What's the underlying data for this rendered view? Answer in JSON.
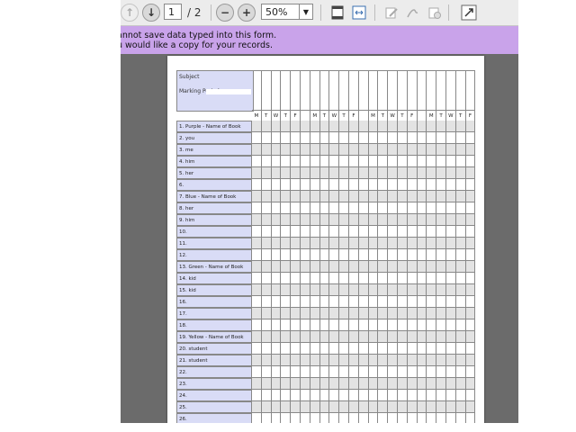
{
  "toolbar": {
    "page_number": "1",
    "page_total": "/ 2",
    "zoom": "50%",
    "prev_icon": "arrow-up-icon",
    "next_icon": "arrow-down-icon",
    "zoom_out_icon": "minus-icon",
    "zoom_in_icon": "plus-icon"
  },
  "notice": {
    "line1": "annot save data typed into this form.",
    "line2": "u would like a copy for your records."
  },
  "form": {
    "subject_label": "Subject",
    "marking_period_label": "Marking Period",
    "days": [
      "M",
      "T",
      "W",
      "T",
      "F",
      "",
      "M",
      "T",
      "W",
      "T",
      "F",
      "",
      "M",
      "T",
      "W",
      "T",
      "F",
      "",
      "M",
      "T",
      "W",
      "T",
      "F"
    ],
    "rows": [
      "1. Purple - Name of Book",
      "2. you",
      "3. me",
      "4. him",
      "5. her",
      "6.",
      "7. Blue - Name of Book",
      "8. her",
      "9. him",
      "10.",
      "11.",
      "12.",
      "13. Green - Name of Book",
      "14. kid",
      "15. kid",
      "16.",
      "17.",
      "18.",
      "19. Yellow - Name of Book",
      "20. student",
      "21. student",
      "22.",
      "23.",
      "24.",
      "25.",
      "26."
    ]
  }
}
